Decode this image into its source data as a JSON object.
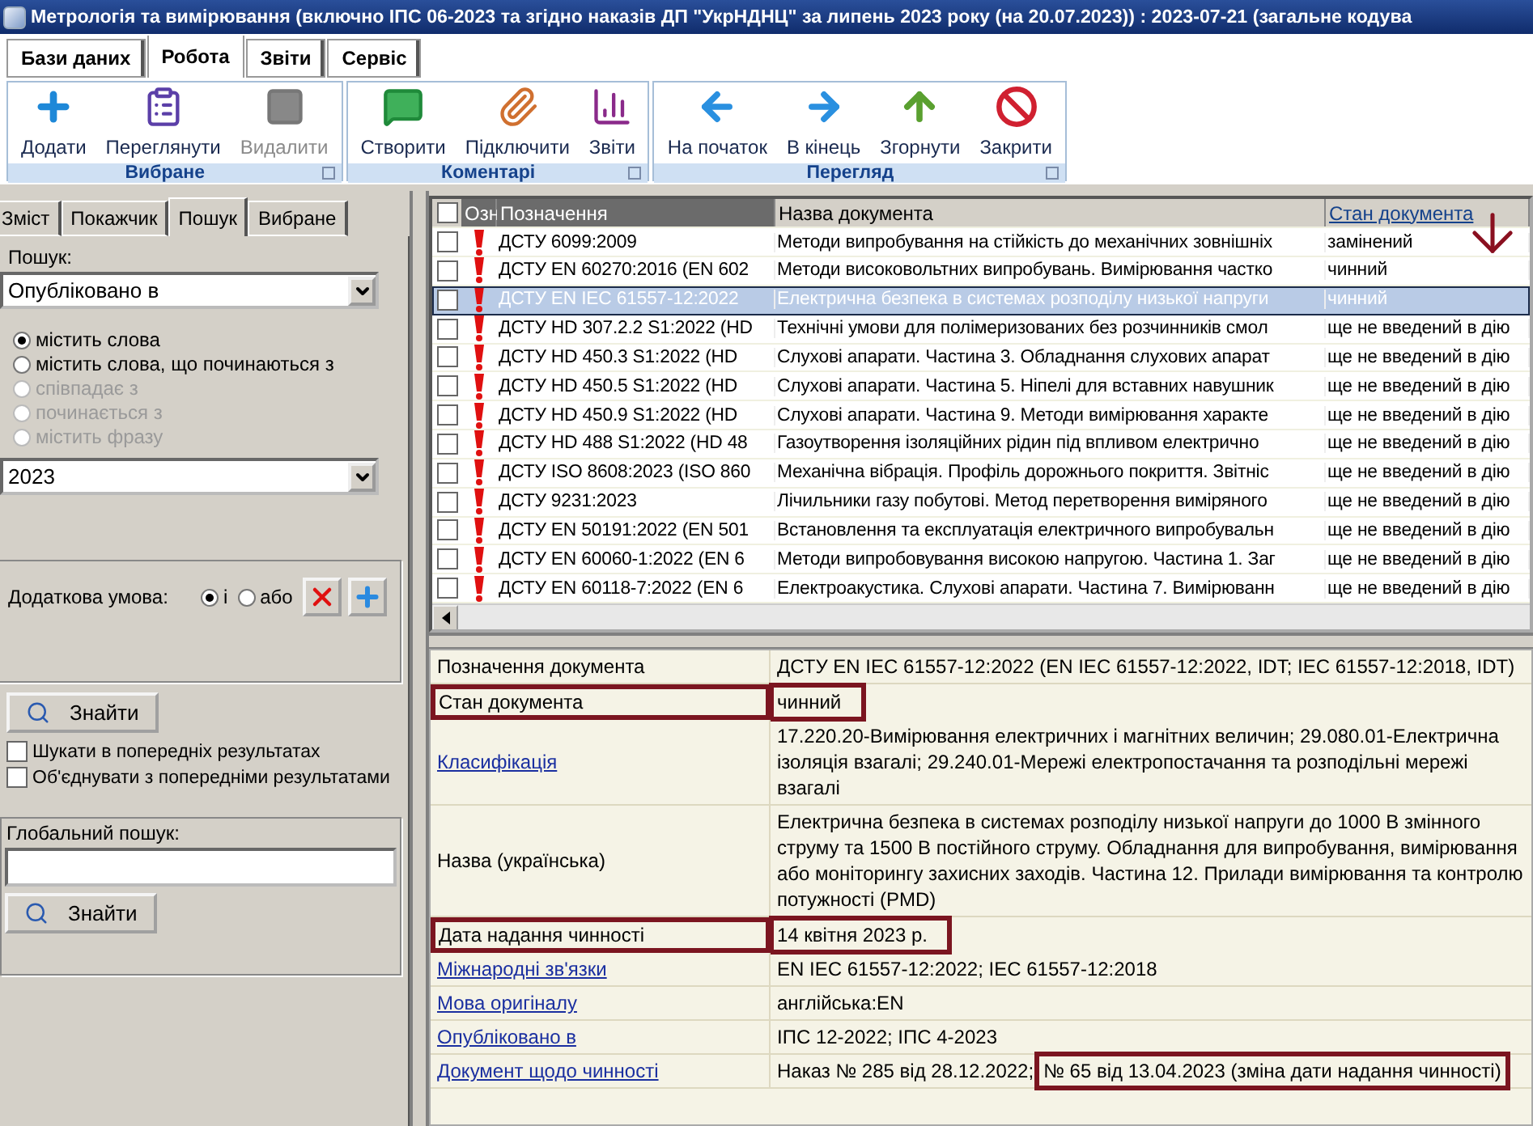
{
  "window": {
    "title": "Метрологія та вимірювання (включно ІПС 06-2023 та згідно наказів ДП \"УкрНДНЦ\"  за липень 2023 року (на 20.07.2023)) : 2023-07-21 (загальне кодува"
  },
  "ribbon": {
    "tabs": [
      {
        "label": "Бази даних",
        "selected": false
      },
      {
        "label": "Робота",
        "selected": true
      },
      {
        "label": "Звіти",
        "selected": false
      },
      {
        "label": "Сервіс",
        "selected": false
      }
    ],
    "groups": [
      {
        "title": "Вибране",
        "buttons": [
          {
            "label": "Додати",
            "kind": "add",
            "disabled": false
          },
          {
            "label": "Переглянути",
            "kind": "view",
            "disabled": false
          },
          {
            "label": "Видалити",
            "kind": "delete",
            "disabled": true
          }
        ]
      },
      {
        "title": "Коментарі",
        "buttons": [
          {
            "label": "Створити",
            "kind": "comment",
            "disabled": false
          },
          {
            "label": "Підключити",
            "kind": "attach",
            "disabled": false
          },
          {
            "label": "Звіти",
            "kind": "report",
            "disabled": false
          }
        ]
      },
      {
        "title": "Перегляд",
        "buttons": [
          {
            "label": "На початок",
            "kind": "back",
            "disabled": false
          },
          {
            "label": "В кінець",
            "kind": "forward",
            "disabled": false
          },
          {
            "label": "Згорнути",
            "kind": "up",
            "disabled": false
          },
          {
            "label": "Закрити",
            "kind": "close",
            "disabled": false
          }
        ]
      }
    ]
  },
  "left_panel": {
    "tabs": [
      {
        "label": "Зміст",
        "selected": false
      },
      {
        "label": "Покажчик",
        "selected": false
      },
      {
        "label": "Пошук",
        "selected": true
      },
      {
        "label": "Вибране",
        "selected": false
      }
    ],
    "search_label": "Пошук:",
    "field_combo": "Опубліковано в",
    "match_options": [
      {
        "label": "містить слова",
        "selected": true,
        "disabled": false
      },
      {
        "label": "містить слова, що починаються з",
        "selected": false,
        "disabled": false
      },
      {
        "label": "співпадає з",
        "selected": false,
        "disabled": true
      },
      {
        "label": "починається з",
        "selected": false,
        "disabled": true
      },
      {
        "label": "містить фразу",
        "selected": false,
        "disabled": true
      }
    ],
    "value_combo": "2023",
    "extra_condition": {
      "label": "Додаткова умова:",
      "options": [
        {
          "label": "і",
          "selected": true
        },
        {
          "label": "або",
          "selected": false
        }
      ]
    },
    "find_button": "Знайти",
    "checkboxes": [
      {
        "label": "Шукати в попередніх результатах",
        "checked": false
      },
      {
        "label": "Об'єднувати з попередніми результатами",
        "checked": false
      }
    ],
    "global_search": {
      "label": "Глобальний пошук:",
      "button": "Знайти"
    }
  },
  "table": {
    "select_all_checked": false,
    "columns": [
      {
        "label": "Озн",
        "dark": true,
        "sorted": false
      },
      {
        "label": "Позначення",
        "dark": true,
        "sorted": false
      },
      {
        "label": "Назва документа",
        "dark": false,
        "sorted": false
      },
      {
        "label": "Стан документа",
        "dark": false,
        "sorted": true
      }
    ],
    "rows": [
      {
        "checked": false,
        "selected": false,
        "designation": "ДСТУ 6099:2009",
        "name": "Методи випробування на стійкість до механічних зовнішніх",
        "status": "замінений"
      },
      {
        "checked": false,
        "selected": false,
        "designation": "ДСТУ EN 60270:2016 (EN 602",
        "name": "Методи високовольтних випробувань. Вимірювання частко",
        "status": "чинний"
      },
      {
        "checked": false,
        "selected": true,
        "designation": "ДСТУ EN IEC 61557-12:2022",
        "name": "Електрична безпека в системах розподілу низької напруги",
        "status": "чинний"
      },
      {
        "checked": false,
        "selected": false,
        "designation": "ДСТУ HD 307.2.2 S1:2022 (HD",
        "name": "Технічні умови для полімеризованих без розчинників смол",
        "status": "ще не введений в дію"
      },
      {
        "checked": false,
        "selected": false,
        "designation": "ДСТУ HD 450.3 S1:2022 (HD",
        "name": "Слухові апарати. Частина 3. Обладнання слухових апарат",
        "status": "ще не введений в дію"
      },
      {
        "checked": false,
        "selected": false,
        "designation": "ДСТУ HD 450.5 S1:2022 (HD",
        "name": "Слухові апарати. Частина 5. Ніпелі для вставних навушник",
        "status": "ще не введений в дію"
      },
      {
        "checked": false,
        "selected": false,
        "designation": "ДСТУ HD 450.9 S1:2022 (HD",
        "name": "Слухові апарати. Частина 9. Методи вимірювання характе",
        "status": "ще не введений в дію"
      },
      {
        "checked": false,
        "selected": false,
        "designation": "ДСТУ HD 488 S1:2022 (HD 48",
        "name": "Газоутворення ізоляційних рідин під впливом електрично",
        "status": "ще не введений в дію"
      },
      {
        "checked": false,
        "selected": false,
        "designation": "ДСТУ ISO 8608:2023 (ISO 860",
        "name": "Механічна вібрація. Профіль дорожнього покриття. Звітніс",
        "status": "ще не введений в дію"
      },
      {
        "checked": false,
        "selected": false,
        "designation": "ДСТУ 9231:2023",
        "name": "Лічильники газу побутові. Метод перетворення виміряного",
        "status": "ще не введений в дію"
      },
      {
        "checked": false,
        "selected": false,
        "designation": "ДСТУ EN 50191:2022 (EN 501",
        "name": "Встановлення та експлуатація електричного випробувальн",
        "status": "ще не введений в дію"
      },
      {
        "checked": false,
        "selected": false,
        "designation": "ДСТУ EN 60060-1:2022 (EN 6",
        "name": "Методи випробовування високою напругою. Частина 1. Заг",
        "status": "ще не введений в дію"
      },
      {
        "checked": false,
        "selected": false,
        "designation": "ДСТУ EN 60118-7:2022 (EN 6",
        "name": "Електроакустика. Слухові апарати. Частина 7. Вимірюванн",
        "status": "ще не введений в дію"
      }
    ]
  },
  "details": {
    "rows": [
      {
        "label": "Позначення документа",
        "link": false,
        "highlighted": false,
        "value_parts": [
          {
            "text": "ДСТУ EN IEC 61557-12:2022 (EN IEC 61557-12:2022, IDT; IEC 61557-12:2018, IDT)",
            "highlighted": false
          }
        ]
      },
      {
        "label": "Стан документа",
        "link": false,
        "highlighted": true,
        "value_parts": [
          {
            "text": "чинний",
            "highlighted": false
          }
        ]
      },
      {
        "label": "Класифікація",
        "link": true,
        "highlighted": false,
        "value_parts": [
          {
            "text": "17.220.20-Вимірювання електричних і магнітних величин; 29.080.01-Електрична ізоляція взагалі; 29.240.01-Мережі електропостачання та розподільні мережі взагалі",
            "highlighted": false
          }
        ]
      },
      {
        "label": "Назва (українська)",
        "link": false,
        "highlighted": false,
        "value_parts": [
          {
            "text": "Електрична безпека в системах розподілу низької напруги до 1000 В змінного струму та 1500 В постійного струму. Обладнання для випробування, вимірювання або моніторингу захисних заходів. Частина 12. Прилади вимірювання та контролю потужності (PMD)",
            "highlighted": false
          }
        ]
      },
      {
        "label": "Дата надання чинності",
        "link": false,
        "highlighted": true,
        "value_parts": [
          {
            "text": "14 квітня 2023 р.",
            "highlighted": false
          }
        ]
      },
      {
        "label": "Міжнародні зв'язки",
        "link": true,
        "highlighted": false,
        "value_parts": [
          {
            "text": "EN IEC 61557-12:2022; IEC 61557-12:2018",
            "highlighted": false
          }
        ]
      },
      {
        "label": "Мова оригіналу",
        "link": true,
        "highlighted": false,
        "value_parts": [
          {
            "text": "англійська:EN",
            "highlighted": false
          }
        ]
      },
      {
        "label": "Опубліковано в",
        "link": true,
        "highlighted": false,
        "value_parts": [
          {
            "text": "ІПС 12-2022; ІПС 4-2023",
            "highlighted": false
          }
        ]
      },
      {
        "label": "Документ щодо чинності",
        "link": true,
        "highlighted": false,
        "value_parts": [
          {
            "text": "Наказ № 285 від 28.12.2022;",
            "highlighted": false
          },
          {
            "text": "№ 65 від 13.04.2023 (зміна дати надання чинності)",
            "highlighted": true
          }
        ]
      }
    ]
  }
}
